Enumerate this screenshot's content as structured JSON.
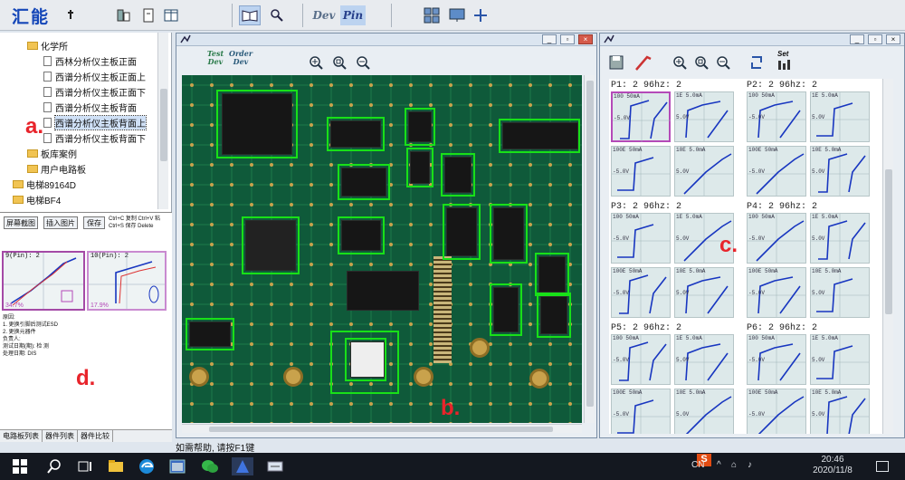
{
  "app": {
    "logo_text": "汇能",
    "tool_dev": "Dev",
    "tool_pin": "Pin"
  },
  "tree": {
    "items": [
      {
        "label": "化学所",
        "type": "folder",
        "indent": 0
      },
      {
        "label": "西林分析仪主板正面",
        "type": "doc",
        "indent": 1
      },
      {
        "label": "西谱分析仪主板正面上",
        "type": "doc",
        "indent": 1
      },
      {
        "label": "西谱分析仪主板正面下",
        "type": "doc",
        "indent": 1
      },
      {
        "label": "西谱分析仪主板背面",
        "type": "doc",
        "indent": 1
      },
      {
        "label": "西谱分析仪主板背面上",
        "type": "doc",
        "indent": 1,
        "selected": true
      },
      {
        "label": "西谱分析仪主板背面下",
        "type": "doc",
        "indent": 1
      },
      {
        "label": "板库案例",
        "type": "folder",
        "indent": 0
      },
      {
        "label": "用户电路板",
        "type": "folder",
        "indent": 0
      },
      {
        "label": "电梯89164D",
        "type": "folder",
        "indent": -1
      },
      {
        "label": "电梯BF4",
        "type": "folder",
        "indent": -1
      }
    ]
  },
  "report": {
    "btn_capture": "屏幕截图",
    "btn_insert": "插入图片",
    "btn_save": "保存",
    "hint1": "Ctrl+C 复制 Ctrl+V 粘",
    "hint2": "Ctrl+S 保存 Delete",
    "chart1_label": "9(Pin): 2",
    "chart2_label": "10(Pin): 2",
    "chart1_pct": "34.7%",
    "chart2_pct": "17.9%",
    "notes": [
      "原因:",
      "1. 更换引脚后测试ESD",
      "2. 更换元器件",
      "负责人:",
      "测试日期(期):  检  测",
      "处理日期:  DIS"
    ],
    "tabs": [
      "电路板列表",
      "器件列表",
      "器件比较"
    ]
  },
  "midwin": {
    "tool1": "Test Dev",
    "tool2": "Order Dev"
  },
  "rightwin": {
    "set_label": "Set"
  },
  "curves": {
    "cells": [
      {
        "label": "P1: 2  96hz: 2",
        "highlight": true
      },
      {
        "label": "P2: 2  96hz: 2",
        "highlight": false
      },
      {
        "label": "P3: 2  96hz: 2",
        "highlight": false
      },
      {
        "label": "P4: 2  96hz: 2",
        "highlight": false
      },
      {
        "label": "P5: 2  96hz: 2",
        "highlight": false
      },
      {
        "label": "P6: 2  96hz: 2",
        "highlight": false
      }
    ],
    "scope_texts": [
      "100 50mA",
      "1E 5.0mA",
      "-5.0V",
      "5.0V",
      "100E 50mA",
      "10E 5.0mA"
    ]
  },
  "annotations": {
    "a": "a.",
    "b": "b.",
    "c": "c.",
    "d": "d."
  },
  "status": {
    "text": "如需帮助, 请按F1键"
  },
  "taskbar": {
    "lang": "CN",
    "time": "20:46",
    "date": "2020/11/8"
  },
  "colors": {
    "accent": "#1446b8",
    "pcb_green": "#0f5a3a",
    "highlight_box": "#18e018",
    "curve_blue": "#1836c0",
    "annotation_red": "#e8242b",
    "scope_highlight": "#b44ab8"
  }
}
